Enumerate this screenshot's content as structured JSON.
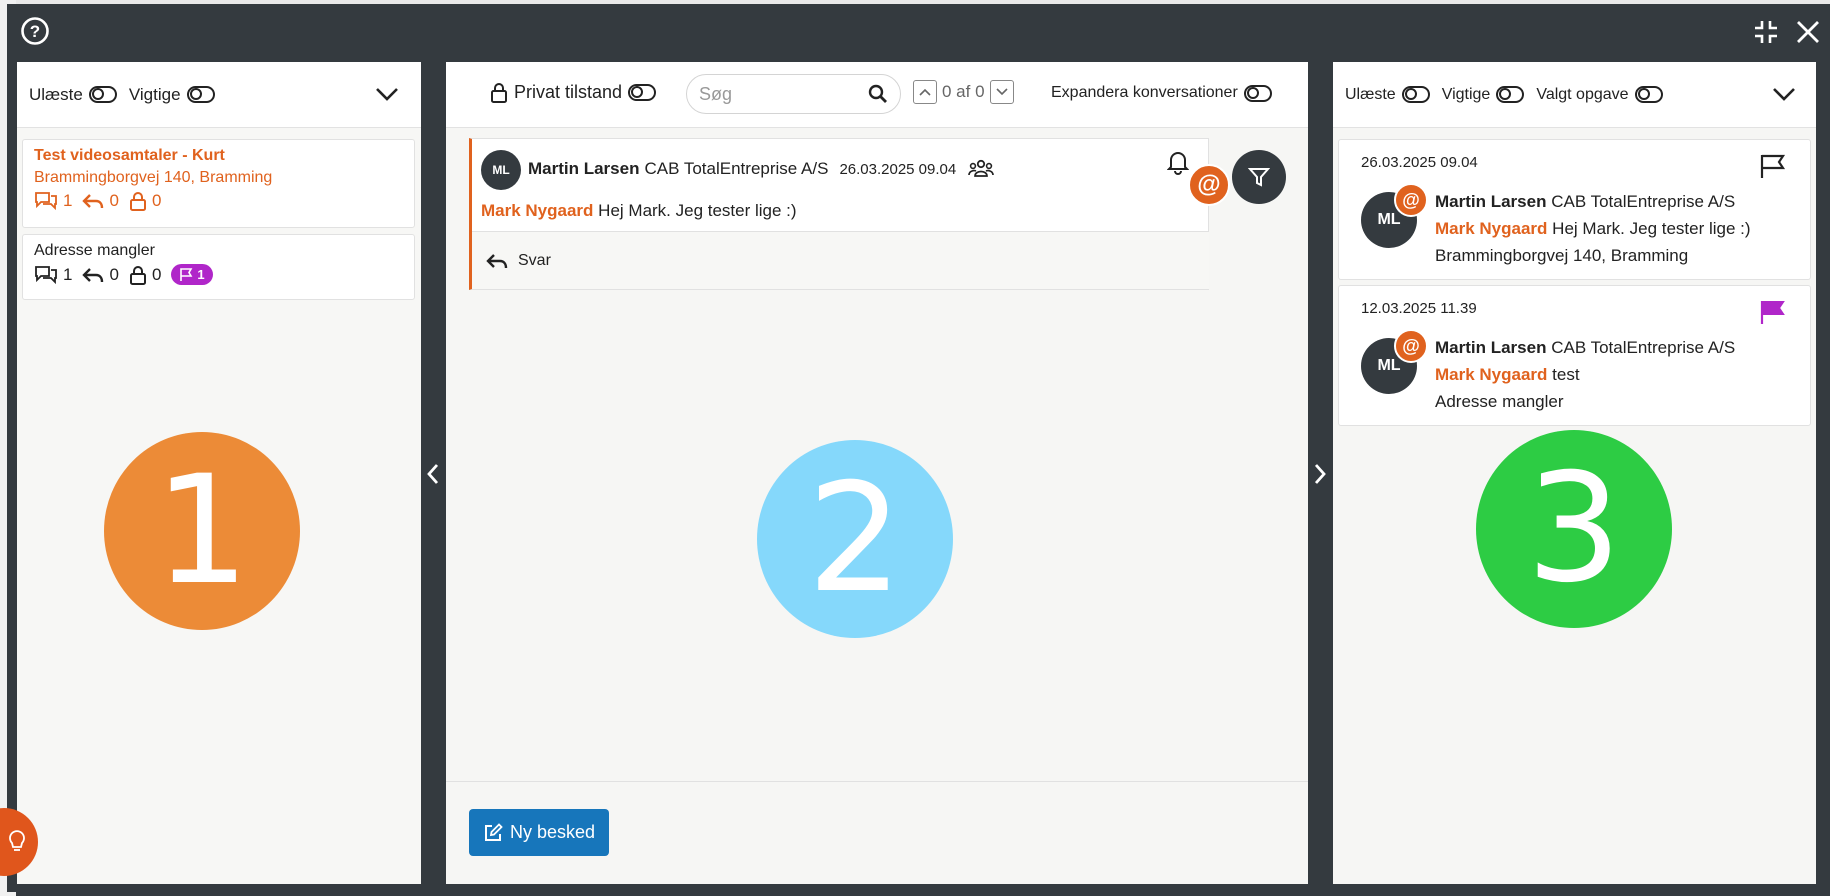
{
  "left_panel": {
    "unread_label": "Ulæste",
    "important_label": "Vigtige",
    "conversations": [
      {
        "title": "Test videosamtaler - Kurt",
        "subtitle": "Brammingborgvej 140, Bramming",
        "messages": "1",
        "replies": "0",
        "locked": "0"
      },
      {
        "title": "Adresse mangler",
        "messages": "1",
        "replies": "0",
        "locked": "0",
        "flag_count": "1"
      }
    ],
    "marker": "1"
  },
  "center_panel": {
    "private_mode_label": "Privat tilstand",
    "search_placeholder": "Søg",
    "pager_text": "0 af 0",
    "expand_label": "Expandera konversationer",
    "message": {
      "avatar_initials": "ML",
      "author": "Martin Larsen",
      "company": "CAB TotalEntreprise A/S",
      "timestamp": "26.03.2025 09.04",
      "mention": "Mark Nygaard",
      "text": "Hej Mark. Jeg tester lige :)",
      "reply_label": "Svar"
    },
    "new_message_label": "Ny besked",
    "marker": "2"
  },
  "right_panel": {
    "unread_label": "Ulæste",
    "important_label": "Vigtige",
    "selected_task_label": "Valgt opgave",
    "items": [
      {
        "timestamp": "26.03.2025 09.04",
        "avatar_initials": "ML",
        "author": "Martin Larsen",
        "company": "CAB TotalEntreprise A/S",
        "mention": "Mark Nygaard",
        "text": "Hej Mark. Jeg tester lige :)",
        "location": "Brammingborgvej 140, Bramming"
      },
      {
        "timestamp": "12.03.2025 11.39",
        "avatar_initials": "ML",
        "author": "Martin Larsen",
        "company": "CAB TotalEntreprise A/S",
        "mention": "Mark Nygaard",
        "text": "test",
        "location": "Adresse mangler"
      }
    ],
    "marker": "3"
  },
  "colors": {
    "accent": "#e0621e",
    "primary_button": "#1776bb",
    "flag_purple": "#b026c9",
    "marker1": "#ec8b37",
    "marker2": "#85d8fb",
    "marker3": "#2dcc44"
  }
}
